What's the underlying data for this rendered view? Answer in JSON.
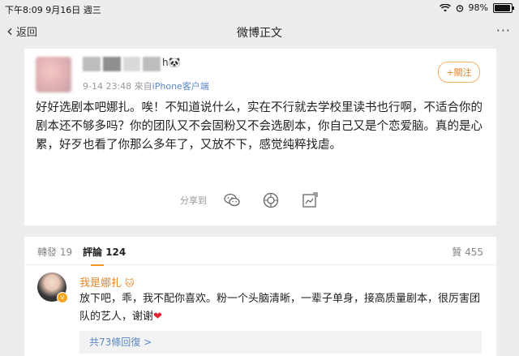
{
  "status_bar": {
    "time": "下午8:09  9月16日 週三",
    "battery": "98%",
    "battery_level": 0.98
  },
  "nav": {
    "back_label": "返回",
    "title": "微博正文",
    "more": "···"
  },
  "post": {
    "author_suffix": "h🐼",
    "timestamp": "9-14 23:48",
    "source_prefix": "來自",
    "source": "iPhone客户端",
    "follow_label": "+關注",
    "text": "好好选剧本吧娜扎。唉！不知道说什么，实在不行就去学校里读书也行啊，不适合你的剧本还不够多吗？你的团队又不会固粉又不会选剧本，你自己又是个恋爱脑。真的是心累，好歹也看了你那么多年了，又放不下，感觉纯粹找虐。",
    "share_label": "分享到",
    "share_icons": [
      "wechat-icon",
      "moments-icon",
      "weibo-share-icon"
    ]
  },
  "comments": {
    "tabs": {
      "repost_label": "轉發",
      "repost_count": "19",
      "comment_label": "評論",
      "comment_count": "124",
      "like_label": "贊",
      "like_count": "455"
    },
    "items": [
      {
        "author": "我是娜扎",
        "badge": "🐱",
        "verified": "v",
        "text": "放下吧，乖，我不配你喜欢。粉一个头脑清晰，一辈子单身，接高质量剧本，很厉害团队的艺人，谢谢",
        "emoji": "❤",
        "replies_label": "共73條回復 >"
      }
    ]
  },
  "colors": {
    "accent": "#e8852a",
    "link": "#5b86c6",
    "background": "#ededed"
  }
}
